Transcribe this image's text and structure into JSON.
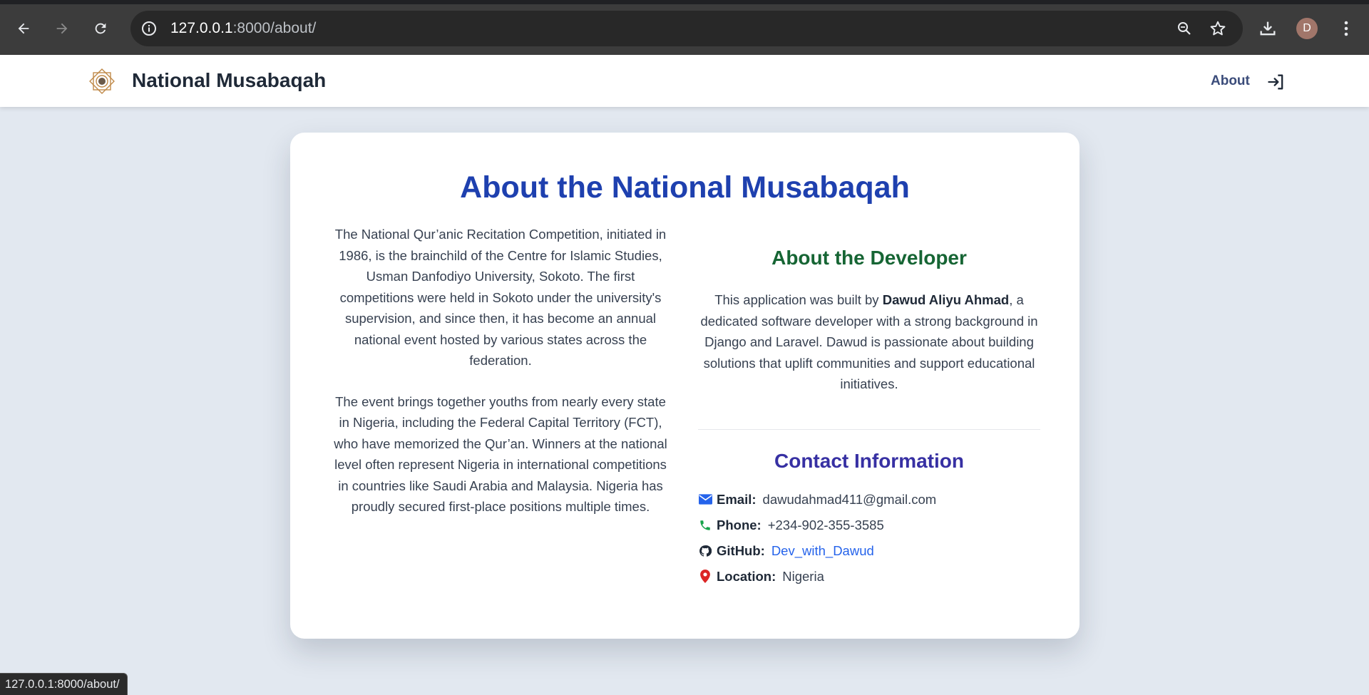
{
  "browser": {
    "url_host": "127.0.0.1",
    "url_rest": ":8000/about/",
    "avatar_letter": "D",
    "status_url": "127.0.0.1:8000/about/"
  },
  "navbar": {
    "brand": "National Musabaqah",
    "about_link": "About"
  },
  "page": {
    "title": "About the National Musabaqah",
    "history_paragraph_1": "The National Qur’anic Recitation Competition, initiated in 1986, is the brainchild of the Centre for Islamic Studies, Usman Danfodiyo University, Sokoto. The first competitions were held in Sokoto under the university's supervision, and since then, it has become an annual national event hosted by various states across the federation.",
    "history_paragraph_2": "The event brings together youths from nearly every state in Nigeria, including the Federal Capital Territory (FCT), who have memorized the Qur’an. Winners at the national level often represent Nigeria in international competitions in countries like Saudi Arabia and Malaysia. Nigeria has proudly secured first-place positions multiple times."
  },
  "developer": {
    "heading": "About the Developer",
    "text_before": "This application was built by ",
    "name": "Dawud Aliyu Ahmad",
    "text_after": ", a dedicated software developer with a strong background in Django and Laravel. Dawud is passionate about building solutions that uplift communities and support educational initiatives."
  },
  "contact": {
    "heading": "Contact Information",
    "email_label": "Email:",
    "email_value": "dawudahmad411@gmail.com",
    "phone_label": "Phone:",
    "phone_value": "+234-902-355-3585",
    "github_label": "GitHub:",
    "github_value": "Dev_with_Dawud",
    "location_label": "Location:",
    "location_value": "Nigeria"
  },
  "colors": {
    "page_bg": "#e2e8f0",
    "title_blue": "#1e40af",
    "developer_green": "#166534",
    "contact_indigo": "#3730a3",
    "link_blue": "#2563eb",
    "email_icon": "#2563eb",
    "phone_icon": "#16a34a",
    "location_icon": "#dc2626"
  },
  "icons": {
    "back": "arrow-left-icon",
    "forward": "arrow-right-icon",
    "reload": "reload-icon",
    "site_info": "info-icon",
    "zoom": "zoom-icon",
    "bookmark": "star-icon",
    "download": "download-icon",
    "menu": "kebab-menu-icon",
    "login": "login-icon",
    "email": "envelope-icon",
    "phone": "phone-icon",
    "github": "github-icon",
    "location": "map-pin-icon"
  }
}
